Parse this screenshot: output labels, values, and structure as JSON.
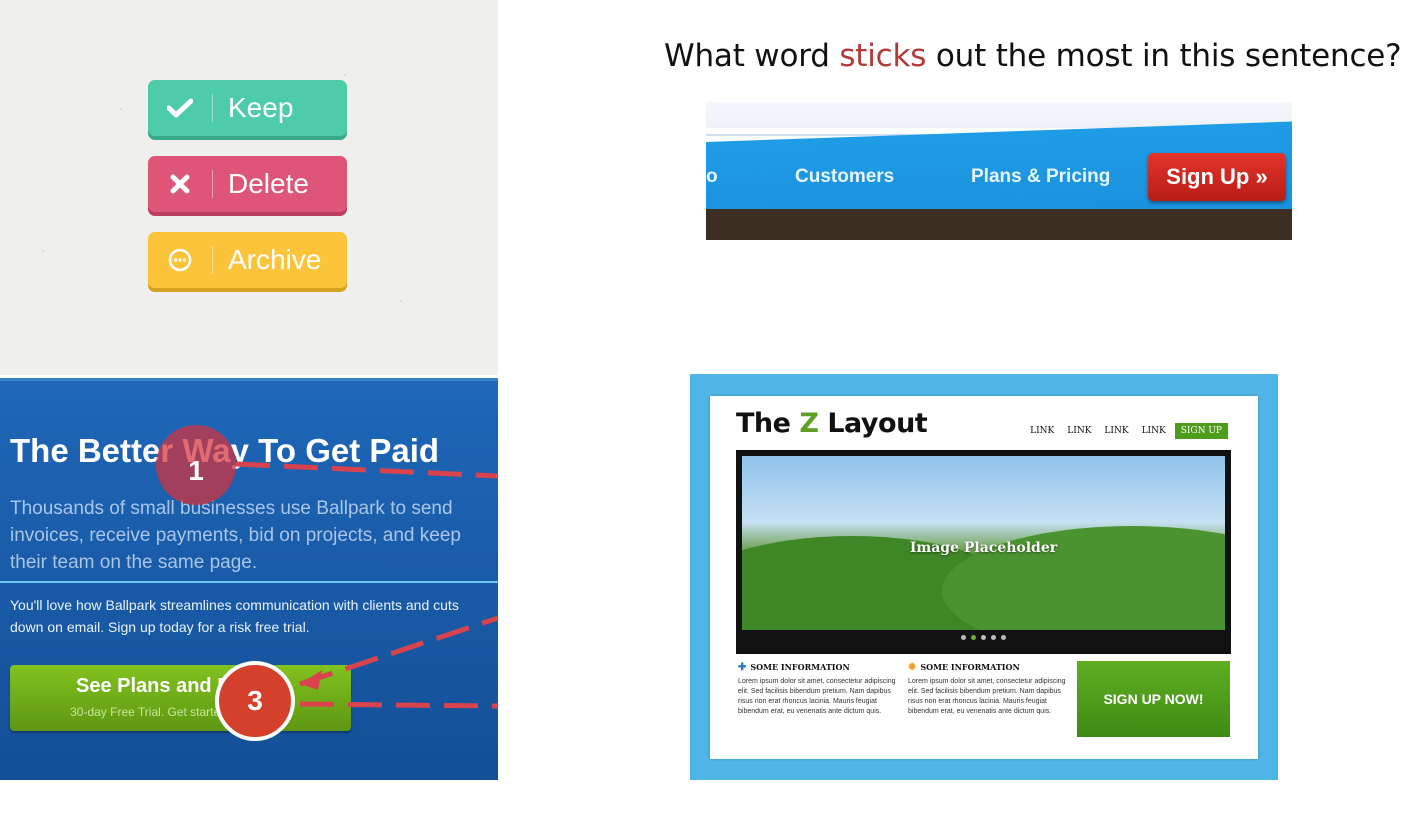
{
  "actions": {
    "keep": {
      "label": "Keep",
      "icon": "checkmark-icon",
      "color": "#4ecba9"
    },
    "delete": {
      "label": "Delete",
      "icon": "x-icon",
      "color": "#df5577"
    },
    "archive": {
      "label": "Archive",
      "icon": "ellipsis-circle-icon",
      "color": "#fcc43a"
    }
  },
  "question": {
    "before": "What word ",
    "highlight": "sticks",
    "after": " out the most in this sentence?",
    "highlight_color": "#b23a3a"
  },
  "nav": {
    "partial_item": "o",
    "items": [
      "Customers",
      "Plans & Pricing"
    ],
    "signup": "Sign Up »"
  },
  "ballpark": {
    "headline": "The Better Way To Get Paid",
    "body1": "Thousands of small businesses use Ballpark to send invoices, receive payments, bid on projects, and keep their team on the same page.",
    "body2": "You'll love how Ballpark streamlines communication with clients and cuts down on email. Sign up today for a risk free trial.",
    "cta_title": "See Plans and Pricing",
    "cta_subtitle": "30-day Free Trial. Get started in seconds.",
    "marker1": "1",
    "marker3": "3"
  },
  "zlayout": {
    "logo_pre": "The ",
    "logo_z": "Z",
    "logo_post": " Layout",
    "links": [
      "LINK",
      "LINK",
      "LINK",
      "LINK"
    ],
    "signup": "SIGN UP",
    "image_placeholder": "Image Placeholder",
    "col1_title": "SOME INFORMATION",
    "col1_text": "Lorem ipsum dolor sit amet, consectetur adipiscing elit. Sed facilisis bibendum pretium. Nam dapibus risus non erat rhoncus lacinia. Mauris feugiat bibendum erat, eu venenatis ante dictum quis.",
    "col2_title": "SOME INFORMATION",
    "col2_text": "Lorem ipsum dolor sit amet, consectetur adipiscing elit. Sed facilisis bibendum pretium. Nam dapibus risus non erat rhoncus lacinia. Mauris feugiat bibendum erat, eu venenatis ante dictum quis.",
    "cta": "SIGN UP NOW!",
    "accent": "#5ea024"
  }
}
